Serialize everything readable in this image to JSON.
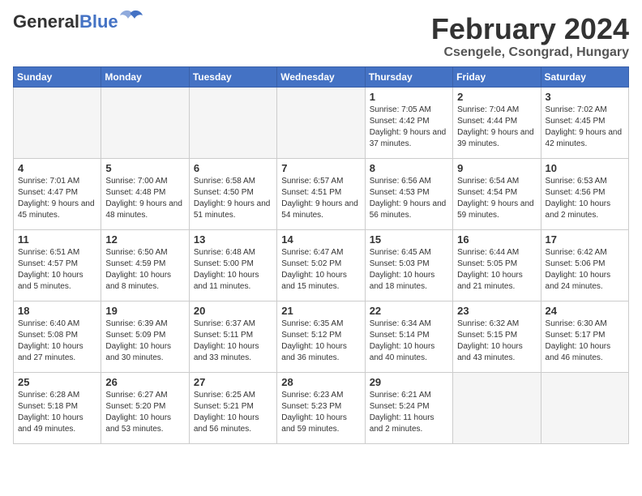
{
  "header": {
    "logo_general": "General",
    "logo_blue": "Blue",
    "title": "February 2024",
    "subtitle": "Csengele, Csongrad, Hungary"
  },
  "days_of_week": [
    "Sunday",
    "Monday",
    "Tuesday",
    "Wednesday",
    "Thursday",
    "Friday",
    "Saturday"
  ],
  "weeks": [
    [
      {
        "day": "",
        "empty": true
      },
      {
        "day": "",
        "empty": true
      },
      {
        "day": "",
        "empty": true
      },
      {
        "day": "",
        "empty": true
      },
      {
        "day": "1",
        "sunrise": "7:05 AM",
        "sunset": "4:42 PM",
        "daylight": "9 hours and 37 minutes."
      },
      {
        "day": "2",
        "sunrise": "7:04 AM",
        "sunset": "4:44 PM",
        "daylight": "9 hours and 39 minutes."
      },
      {
        "day": "3",
        "sunrise": "7:02 AM",
        "sunset": "4:45 PM",
        "daylight": "9 hours and 42 minutes."
      }
    ],
    [
      {
        "day": "4",
        "sunrise": "7:01 AM",
        "sunset": "4:47 PM",
        "daylight": "9 hours and 45 minutes."
      },
      {
        "day": "5",
        "sunrise": "7:00 AM",
        "sunset": "4:48 PM",
        "daylight": "9 hours and 48 minutes."
      },
      {
        "day": "6",
        "sunrise": "6:58 AM",
        "sunset": "4:50 PM",
        "daylight": "9 hours and 51 minutes."
      },
      {
        "day": "7",
        "sunrise": "6:57 AM",
        "sunset": "4:51 PM",
        "daylight": "9 hours and 54 minutes."
      },
      {
        "day": "8",
        "sunrise": "6:56 AM",
        "sunset": "4:53 PM",
        "daylight": "9 hours and 56 minutes."
      },
      {
        "day": "9",
        "sunrise": "6:54 AM",
        "sunset": "4:54 PM",
        "daylight": "9 hours and 59 minutes."
      },
      {
        "day": "10",
        "sunrise": "6:53 AM",
        "sunset": "4:56 PM",
        "daylight": "10 hours and 2 minutes."
      }
    ],
    [
      {
        "day": "11",
        "sunrise": "6:51 AM",
        "sunset": "4:57 PM",
        "daylight": "10 hours and 5 minutes."
      },
      {
        "day": "12",
        "sunrise": "6:50 AM",
        "sunset": "4:59 PM",
        "daylight": "10 hours and 8 minutes."
      },
      {
        "day": "13",
        "sunrise": "6:48 AM",
        "sunset": "5:00 PM",
        "daylight": "10 hours and 11 minutes."
      },
      {
        "day": "14",
        "sunrise": "6:47 AM",
        "sunset": "5:02 PM",
        "daylight": "10 hours and 15 minutes."
      },
      {
        "day": "15",
        "sunrise": "6:45 AM",
        "sunset": "5:03 PM",
        "daylight": "10 hours and 18 minutes."
      },
      {
        "day": "16",
        "sunrise": "6:44 AM",
        "sunset": "5:05 PM",
        "daylight": "10 hours and 21 minutes."
      },
      {
        "day": "17",
        "sunrise": "6:42 AM",
        "sunset": "5:06 PM",
        "daylight": "10 hours and 24 minutes."
      }
    ],
    [
      {
        "day": "18",
        "sunrise": "6:40 AM",
        "sunset": "5:08 PM",
        "daylight": "10 hours and 27 minutes."
      },
      {
        "day": "19",
        "sunrise": "6:39 AM",
        "sunset": "5:09 PM",
        "daylight": "10 hours and 30 minutes."
      },
      {
        "day": "20",
        "sunrise": "6:37 AM",
        "sunset": "5:11 PM",
        "daylight": "10 hours and 33 minutes."
      },
      {
        "day": "21",
        "sunrise": "6:35 AM",
        "sunset": "5:12 PM",
        "daylight": "10 hours and 36 minutes."
      },
      {
        "day": "22",
        "sunrise": "6:34 AM",
        "sunset": "5:14 PM",
        "daylight": "10 hours and 40 minutes."
      },
      {
        "day": "23",
        "sunrise": "6:32 AM",
        "sunset": "5:15 PM",
        "daylight": "10 hours and 43 minutes."
      },
      {
        "day": "24",
        "sunrise": "6:30 AM",
        "sunset": "5:17 PM",
        "daylight": "10 hours and 46 minutes."
      }
    ],
    [
      {
        "day": "25",
        "sunrise": "6:28 AM",
        "sunset": "5:18 PM",
        "daylight": "10 hours and 49 minutes."
      },
      {
        "day": "26",
        "sunrise": "6:27 AM",
        "sunset": "5:20 PM",
        "daylight": "10 hours and 53 minutes."
      },
      {
        "day": "27",
        "sunrise": "6:25 AM",
        "sunset": "5:21 PM",
        "daylight": "10 hours and 56 minutes."
      },
      {
        "day": "28",
        "sunrise": "6:23 AM",
        "sunset": "5:23 PM",
        "daylight": "10 hours and 59 minutes."
      },
      {
        "day": "29",
        "sunrise": "6:21 AM",
        "sunset": "5:24 PM",
        "daylight": "11 hours and 2 minutes."
      },
      {
        "day": "",
        "empty": true
      },
      {
        "day": "",
        "empty": true
      }
    ]
  ]
}
